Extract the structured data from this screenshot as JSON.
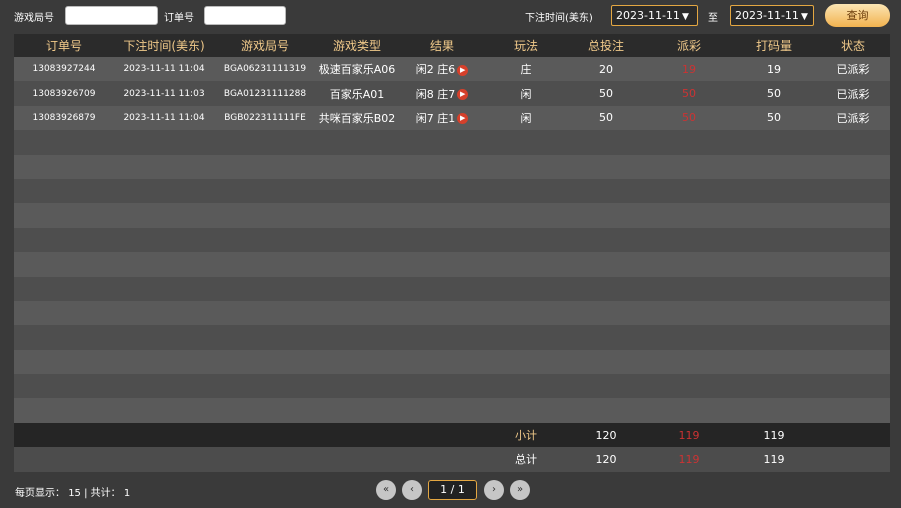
{
  "filters": {
    "round_label": "游戏局号",
    "round_value": "",
    "order_label": "订单号",
    "order_value": "",
    "time_label": "下注时间(美东)",
    "date_from": "2023-11-11",
    "to_label": "至",
    "date_to": "2023-11-11",
    "dropdown_arrow": "▼",
    "query_label": "查询"
  },
  "table": {
    "headers": [
      "订单号",
      "下注时间(美东)",
      "游戏局号",
      "游戏类型",
      "结果",
      "玩法",
      "总投注",
      "派彩",
      "打码量",
      "状态"
    ],
    "rows": [
      {
        "order": "13083927244",
        "time": "2023-11-11 11:04",
        "round": "BGA06231111319",
        "type": "极速百家乐A06",
        "result": "闲2 庄6",
        "play": "庄",
        "bet": "20",
        "payout": "19",
        "turnover": "19",
        "status": "已派彩"
      },
      {
        "order": "13083926709",
        "time": "2023-11-11 11:03",
        "round": "BGA01231111288",
        "type": "百家乐A01",
        "result": "闲8 庄7",
        "play": "闲",
        "bet": "50",
        "payout": "50",
        "turnover": "50",
        "status": "已派彩"
      },
      {
        "order": "13083926879",
        "time": "2023-11-11 11:04",
        "round": "BGB022311111FE",
        "type": "共咪百家乐B02",
        "result": "闲7 庄1",
        "play": "闲",
        "bet": "50",
        "payout": "50",
        "turnover": "50",
        "status": "已派彩"
      }
    ],
    "empty_rows": 12,
    "subtotal": {
      "label": "小计",
      "bet": "120",
      "payout": "119",
      "turnover": "119"
    },
    "total": {
      "label": "总计",
      "bet": "120",
      "payout": "119",
      "turnover": "119"
    }
  },
  "footer": {
    "per_page_label": "每页显示：",
    "per_page": "15",
    "separator": "|",
    "total_label": "共计：",
    "total": "1"
  },
  "pager": {
    "page_display": "1 / 1",
    "first": "«",
    "prev": "‹",
    "next": "›",
    "last": "»"
  }
}
